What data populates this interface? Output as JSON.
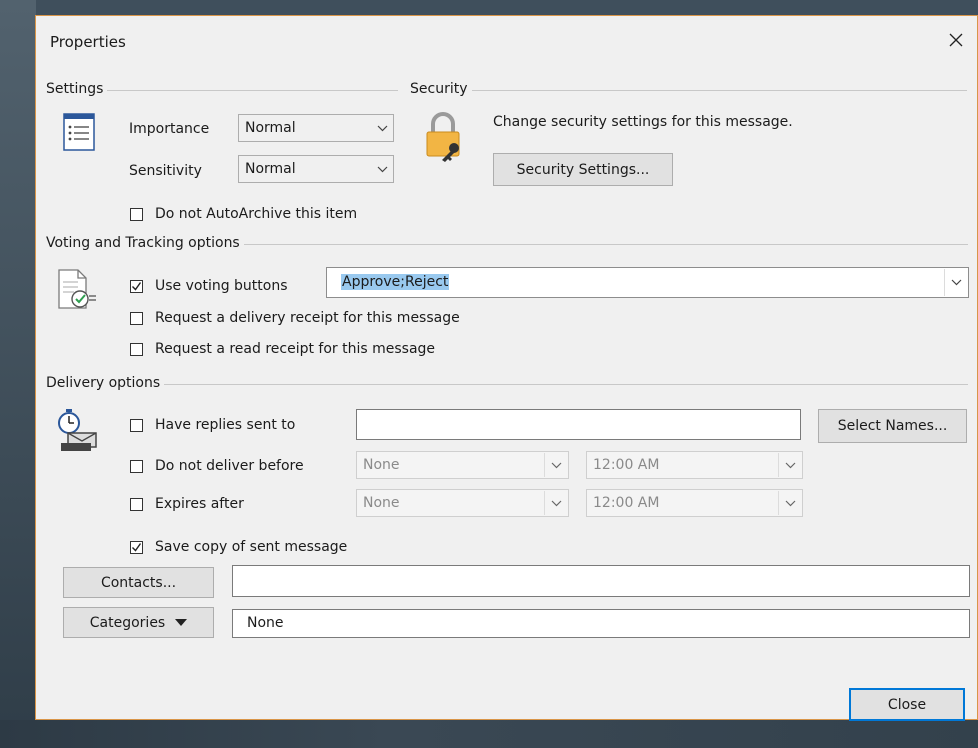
{
  "dialog": {
    "title": "Properties"
  },
  "settings": {
    "heading": "Settings",
    "importance_label": "Importance",
    "importance_value": "Normal",
    "sensitivity_label": "Sensitivity",
    "sensitivity_value": "Normal",
    "autoarchive_label": "Do not AutoArchive this item"
  },
  "security": {
    "heading": "Security",
    "description": "Change security settings for this message.",
    "button_label": "Security Settings..."
  },
  "voting": {
    "heading": "Voting and Tracking options",
    "use_voting_label": "Use voting buttons",
    "use_voting_checked": true,
    "voting_value": "Approve;Reject",
    "delivery_receipt_label": "Request a delivery receipt for this message",
    "read_receipt_label": "Request a read receipt for this message"
  },
  "delivery": {
    "heading": "Delivery options",
    "replies_label": "Have replies sent to",
    "replies_value": "",
    "select_names_label": "Select Names...",
    "not_before_label": "Do not deliver before",
    "not_before_date": "None",
    "not_before_time": "12:00 AM",
    "expires_label": "Expires after",
    "expires_date": "None",
    "expires_time": "12:00 AM",
    "save_copy_label": "Save copy of sent message",
    "save_copy_checked": true
  },
  "contacts": {
    "button_label": "Contacts...",
    "value": ""
  },
  "categories": {
    "button_label": "Categories",
    "value": "None"
  },
  "footer": {
    "close_label": "Close"
  },
  "colors": {
    "dialog_border": "#d99548",
    "default_button_border": "#0078d7",
    "selection_highlight": "#99c9ef"
  }
}
